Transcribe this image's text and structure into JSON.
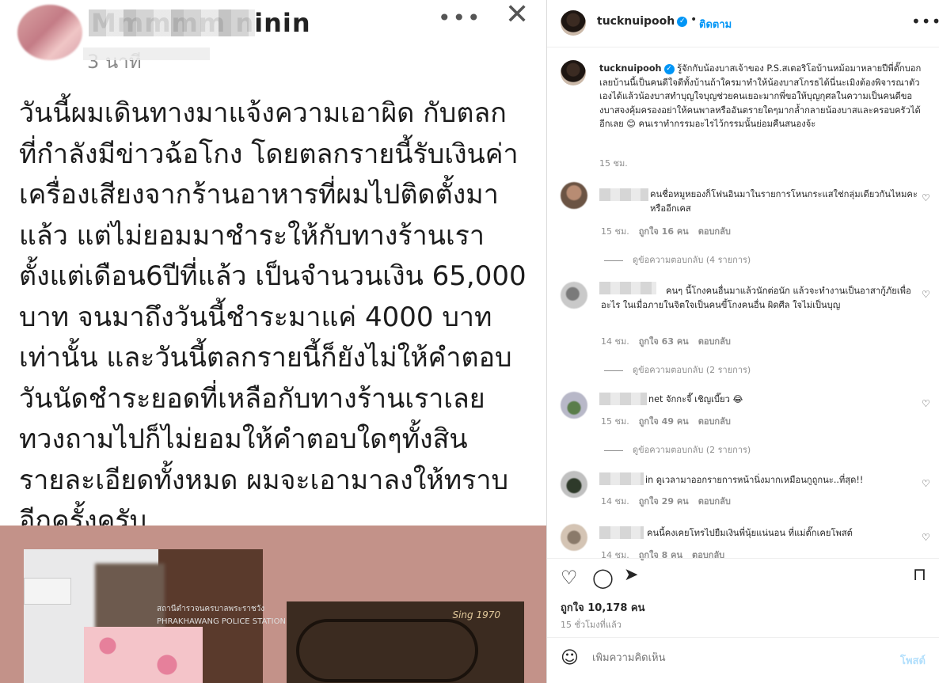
{
  "left_post": {
    "name": "Mmmmm ninin",
    "time": "3 นาที",
    "more_icon": "more-horizontal-icon",
    "close_icon": "close-icon",
    "body_lines": [
      "วันนี้ผมเดินทางมาแจ้งความเอาผิด กับตลก",
      "ที่กำลังมีข่าวฉ้อโกง โดยตลกรายนี้รับเงินค่า",
      "เครื่องเสียงจากร้านอาหารที่ผมไปติดตั้งมา",
      "แล้ว แต่ไม่ยอมมาชำระให้กับทางร้านเรา",
      "ตั้งแต่เดือน6ปีที่แล้ว เป็นจำนวนเงิน 65,000",
      "บาท จนมาถึงวันนี้ชำระมาแค่ 4000 บาท",
      "เท่านั้น และวันนี้ตลกรายนี้ก็ยังไม่ให้คำตอบ",
      "วันนัดชำระยอดที่เหลือกับทางร้านเราเลย",
      "ทวงถามไปก็ไม่ยอมให้คำตอบใดๆทั้งสิน",
      "รายละเอียดทั้งหมด ผมจะเอามาลงให้ทราบ",
      "อีกครั้งครับ"
    ],
    "photo1_sign_th": "สถานีตำรวจนครบาลพระราชวัง",
    "photo1_sign_en": "PHRAKHAWANG POLICE STATION",
    "photo2_sign": "Sing 1970"
  },
  "instagram": {
    "header": {
      "username": "tucknuipooh",
      "follow": "ติดตาม",
      "more_icon": "more-horizontal-icon"
    },
    "caption": {
      "username": "tucknuipooh",
      "text": "รู้จักกับน้องบาสเจ้าของ P.S.สเตอริโอบ้านหม้อมาหลายปีพี่ตั๊กบอกเลยบ้านนี้เป็นคนดีใจดีทั้งบ้านถ้าใครมาทำให้น้องบาสโกรธได้นี่นะเมิงต้องพิจารณาตัวเองได้แล้วน้องบาสทำบุญใจบุญช่วยคนเยอะมากพี่ขอให้บุญกุศลในความเป็นคนดีของบาสจงคุ้มครองอย่าให้คนพาลหรืออันตรายใดๆมากล้ำกลายน้องบาสและครอบครัวได้อีกเลย 😊 คนเราทำกรรมอะไรไว้กรรมนั้นย่อมคืนสนองจ้ะ",
      "time": "15 ชม."
    },
    "comments": [
      {
        "user_visible": "",
        "text": "คนชื่อหมูหยองก็โฟนอินมาในรายการโหนกระแสใช่กลุ่มเดียวกันไหมคะหรืออีกเคส",
        "time": "15 ชม.",
        "likes": "ถูกใจ 16 คน",
        "reply": "ตอบกลับ",
        "view_replies": "ดูข้อความตอบกลับ (4 รายการ)"
      },
      {
        "user_visible": "",
        "text": "คนๆ นี้โกงคนอื่นมาแล้วนักต่อนัก แล้วจะทำงานเป็นอาสากู้ภัยเพื่ออะไร ในเมื่อภายในจิตใจเป็นคนขี้โกงคนอื่น ผิดศีล ใจไม่เป็นบุญ",
        "time": "14 ชม.",
        "likes": "ถูกใจ 63 คน",
        "reply": "ตอบกลับ",
        "view_replies": "ดูข้อความตอบกลับ (2 รายการ)"
      },
      {
        "user_visible": "net",
        "text": "จักกะจี๊ เชิญเบี๊ยว 😂",
        "time": "15 ชม.",
        "likes": "ถูกใจ 49 คน",
        "reply": "ตอบกลับ",
        "view_replies": "ดูข้อความตอบกลับ (2 รายการ)"
      },
      {
        "user_visible": "in",
        "text": "ดูเวลามาออกรายการหน้านิ่งมากเหมือนกูถูกนะ..ที่สุด!!",
        "time": "14 ชม.",
        "likes": "ถูกใจ 29 คน",
        "reply": "ตอบกลับ",
        "view_replies": ""
      },
      {
        "user_visible": "",
        "text": "คนนี้คงเคยโทรไปยืมเงินพี่นุ้ยแน่นอน ที่แม่ตั๊กเคยโพสต์",
        "time": "14 ชม.",
        "likes": "ถูกใจ 8 คน",
        "reply": "ตอบกลับ",
        "view_replies": ""
      }
    ],
    "actions": {
      "like_icon": "heart-icon",
      "comment_icon": "comment-icon",
      "share_icon": "send-icon",
      "save_icon": "bookmark-icon"
    },
    "likes": "ถูกใจ 10,178 คน",
    "post_time": "15 ชั่วโมงที่แล้ว",
    "add_comment": {
      "emoji_icon": "emoji-icon",
      "placeholder": "เพิ่มความคิดเห็น",
      "post": "โพสต์"
    }
  }
}
